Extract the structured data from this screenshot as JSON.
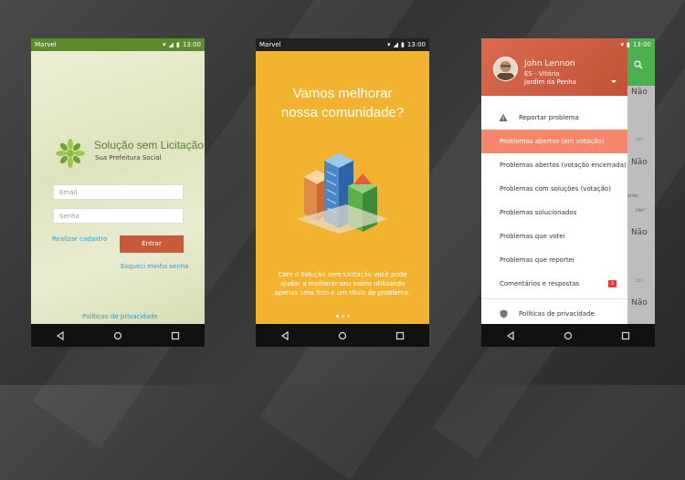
{
  "phones": [
    {
      "status": {
        "carrier": "Marvel",
        "time": "13:00"
      },
      "logo": {
        "title": "Solução sem Licitação",
        "subtitle": "Sua Prefeitura Social"
      },
      "email_placeholder": "Email",
      "password_placeholder": "Senha",
      "register_link": "Realizar cadastro",
      "login_button": "Entrar",
      "forgot_link": "Esqueci minha senha",
      "privacy_link": "Políticas de privacidade"
    },
    {
      "status": {
        "carrier": "Marvel",
        "time": "13:00"
      },
      "headline_line1": "Vamos melhorar",
      "headline_line2": "nossa comunidade?",
      "description": "Com o Solução sem Licitação você pode ajudar a melhorar seu bairro utilizando apenas uma foto e um título de problema."
    },
    {
      "status": {
        "time": "13:00"
      },
      "user": {
        "name": "John Lennon",
        "state_city": "ES - Vitória",
        "neighborhood": "Jardim da Penha"
      },
      "menu": [
        {
          "label": "Reportar problema",
          "icon": "warning-icon"
        },
        {
          "label": "Problemas abertos (em votação)",
          "active": true
        },
        {
          "label": "Problemas abertos (votação encerrada)"
        },
        {
          "label": "Problemas com soluções (votação)"
        },
        {
          "label": "Problemas solucionados"
        },
        {
          "label": "Problemas que votei"
        },
        {
          "label": "Problemas que reportei"
        },
        {
          "label": "Comentários e respostas",
          "badge": "2"
        },
        {
          "label": "Políticas de privacidade",
          "icon": "shield-icon"
        }
      ],
      "background": {
        "nao": "Não",
        "counts": [
          "137",
          "2987",
          "113"
        ],
        "fragment": "ente"
      }
    }
  ],
  "colors": {
    "green": "#5b8c2e",
    "orange": "#f2b430",
    "coral": "#f4876e",
    "red": "#c85a3c"
  }
}
